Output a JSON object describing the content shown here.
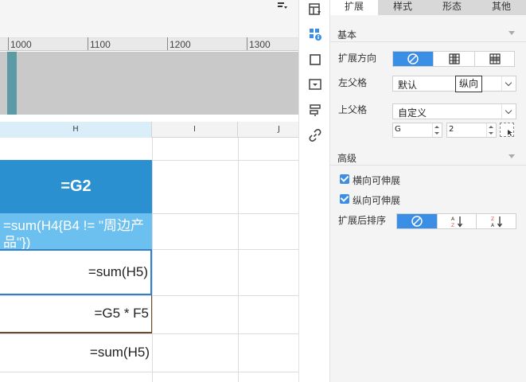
{
  "ruler": {
    "labels": [
      "1000",
      "1100",
      "1200",
      "1300"
    ]
  },
  "columns": {
    "h": "H",
    "i": "I",
    "j": "J"
  },
  "cells": {
    "g2": "=G2",
    "sum_h4": "=sum(H4{B4 != \"周边产品\"})",
    "sum_h5": "=sum(H5)",
    "g5f5": "=G5 * F5",
    "sum_h5_b": "=sum(H5)"
  },
  "panel": {
    "tabs": [
      "扩展",
      "样式",
      "形态",
      "其他"
    ],
    "active_tab": "扩展",
    "basic": {
      "title": "基本",
      "direction_label": "扩展方向",
      "left_parent_label": "左父格",
      "left_parent_value": "默认",
      "tooltip": "纵向",
      "top_parent_label": "上父格",
      "top_parent_value": "自定义",
      "top_parent_col": "G",
      "top_parent_row": "2"
    },
    "advanced": {
      "title": "高级",
      "horizontal_expand": "横向可伸展",
      "vertical_expand": "纵向可伸展",
      "sort_label": "扩展后排序"
    }
  },
  "colors": {
    "accent": "#3a8ee6",
    "cell_blue": "#2b90d0",
    "cell_light_blue": "#6cc0ef"
  }
}
